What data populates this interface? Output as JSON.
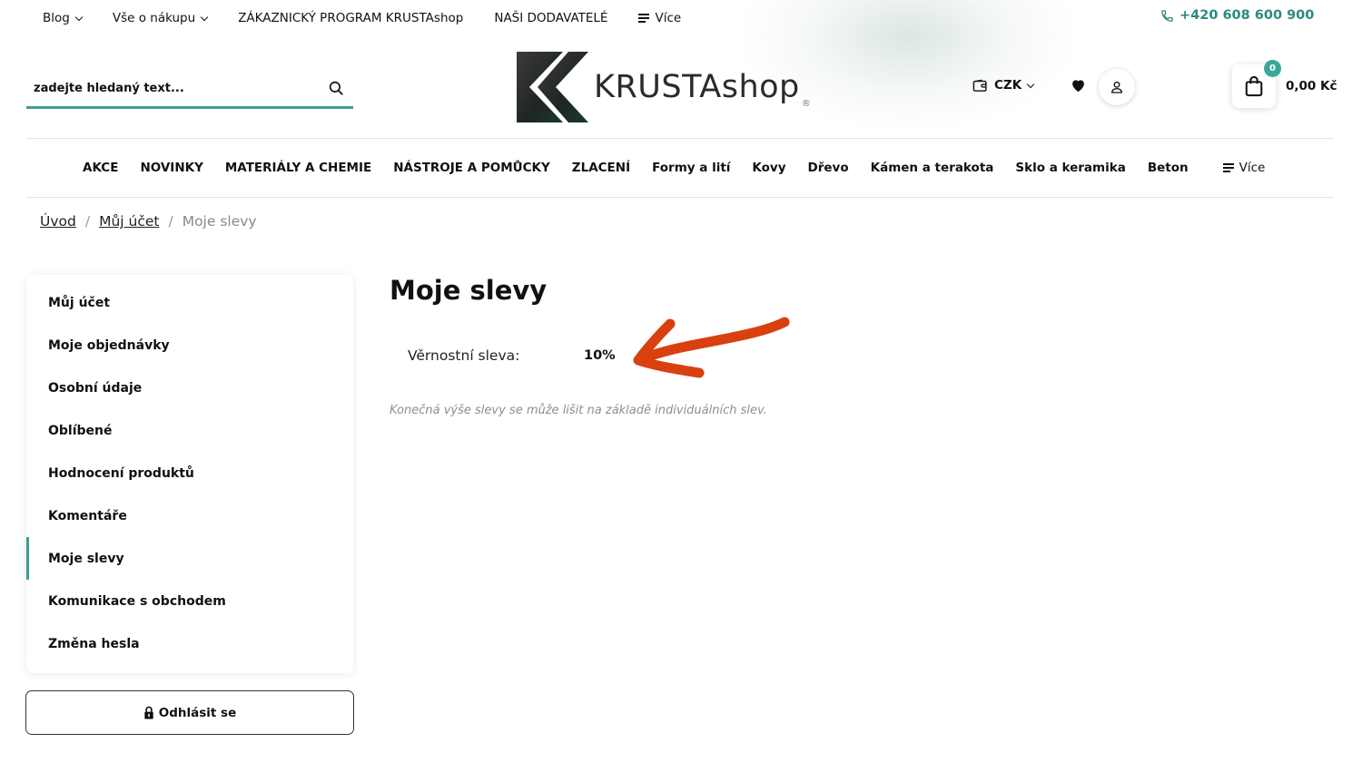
{
  "top_nav": {
    "items": [
      {
        "label": "Blog",
        "dropdown": true
      },
      {
        "label": "Vše o nákupu",
        "dropdown": true
      },
      {
        "label": "ZÁKAZNICKÝ PROGRAM KRUSTAshop",
        "dropdown": false
      },
      {
        "label": "NAŠI DODAVATELÉ",
        "dropdown": false
      }
    ],
    "more_label": "Více",
    "phone": "+420 608 600 900"
  },
  "search": {
    "placeholder": "zadejte hledaný text..."
  },
  "logo": {
    "text": "KRUSTAshop",
    "registered": "®"
  },
  "header": {
    "currency": "CZK",
    "cart_count": "0",
    "cart_total": "0,00 Kč"
  },
  "category_nav": {
    "items": [
      "AKCE",
      "NOVINKY",
      "MATERIÁLY A CHEMIE",
      "NÁSTROJE A POMŮCKY",
      "ZLACENÍ",
      "Formy a lití",
      "Kovy",
      "Dřevo",
      "Kámen a terakota",
      "Sklo a keramika",
      "Beton"
    ],
    "more_label": "Více"
  },
  "breadcrumb": {
    "items": [
      "Úvod",
      "Můj účet"
    ],
    "current": "Moje slevy",
    "separator": "/"
  },
  "sidebar": {
    "items": [
      "Můj účet",
      "Moje objednávky",
      "Osobní údaje",
      "Oblíbené",
      "Hodnocení produktů",
      "Komentáře",
      "Moje slevy",
      "Komunikace s obchodem",
      "Změna hesla"
    ],
    "active": "Moje slevy",
    "logout_label": "Odhlásit se"
  },
  "main": {
    "title": "Moje slevy",
    "discount_label": "Věrnostní sleva:",
    "discount_value": "10%",
    "note": "Konečná výše slevy se může lišit na základě individuálních slev."
  },
  "colors": {
    "accent": "#3a9e92",
    "phone": "#2d8a7e",
    "arrow": "#d9400f",
    "note": "#8a8f96"
  }
}
